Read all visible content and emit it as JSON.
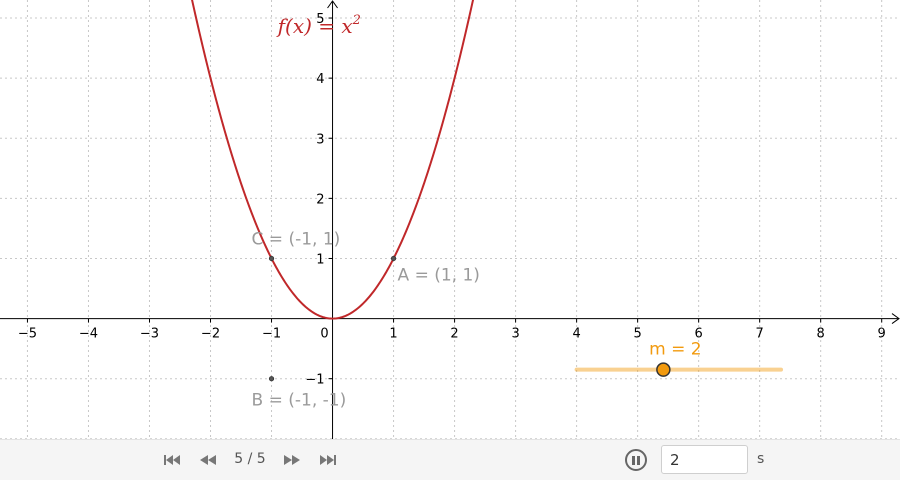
{
  "graph": {
    "x_range": [
      -5.45,
      9.3
    ],
    "y_range": [
      -2.02,
      5.3
    ],
    "x_ticks": [
      "−5",
      "−4",
      "−3",
      "−2",
      "−1",
      "0",
      "1",
      "2",
      "3",
      "4",
      "5",
      "6",
      "7",
      "8",
      "9"
    ],
    "y_ticks": [
      "−1",
      "1",
      "2",
      "3",
      "4",
      "5"
    ],
    "function": {
      "label": "f(x) = x",
      "exponent": "2",
      "color": "#c0282a"
    },
    "points": [
      {
        "id": "A",
        "label": "A = (1, 1)",
        "x": 1,
        "y": 1
      },
      {
        "id": "C",
        "label": "C = (-1, 1)",
        "x": -1,
        "y": 1
      },
      {
        "id": "B",
        "label": "B = (-1, -1)",
        "x": -1,
        "y": -1
      }
    ],
    "slider": {
      "label": "m = 2",
      "value": 2,
      "min": 0,
      "max": 5,
      "color": "#f29a0e"
    }
  },
  "toolbar": {
    "page_indicator": "5 / 5",
    "speed_value": "2",
    "speed_unit": "s"
  }
}
